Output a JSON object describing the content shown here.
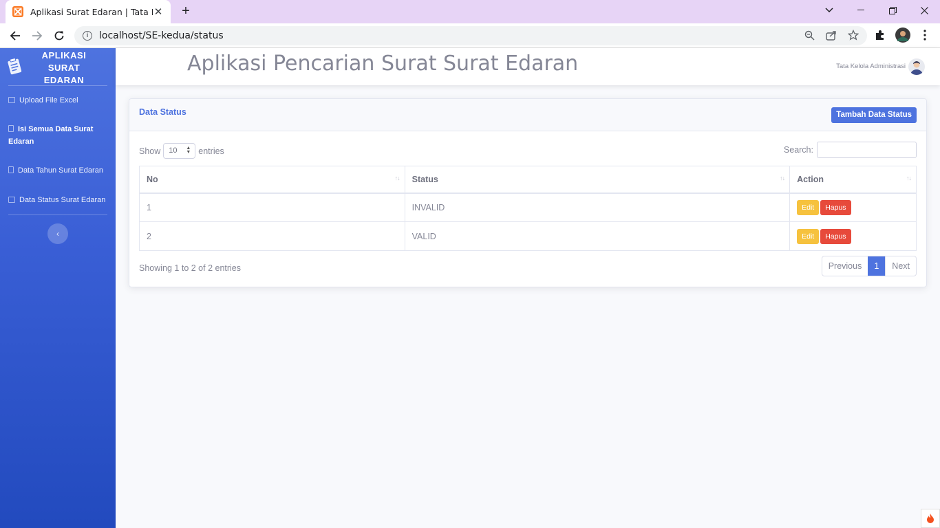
{
  "browser": {
    "tab_title": "Aplikasi Surat Edaran | Tata Kelola",
    "tab_close": "✕",
    "new_tab": "+",
    "url": "localhost/SE-kedua/status"
  },
  "sidebar": {
    "brand_lines": [
      "APLIKASI",
      "SURAT",
      "EDARAN"
    ],
    "items": [
      {
        "label": "Upload File Excel",
        "icon": "table-icon"
      },
      {
        "label": "Isi Semua Data Surat Edaran",
        "icon": "file-icon"
      },
      {
        "label": "Data Tahun Surat Edaran",
        "icon": "calendar-icon"
      },
      {
        "label": "Data Status Surat Edaran",
        "icon": "table-icon"
      }
    ],
    "toggle_glyph": "‹"
  },
  "topbar": {
    "title": "Aplikasi Pencarian Surat Surat Edaran",
    "user_name": "Tata Kelola Administrasi"
  },
  "card": {
    "title": "Data Status",
    "add_button": "Tambah Data Status",
    "length": {
      "show": "Show",
      "value": "10",
      "entries": "entries"
    },
    "search_label": "Search:",
    "columns": [
      "No",
      "Status",
      "Action"
    ],
    "rows": [
      {
        "no": "1",
        "status": "INVALID"
      },
      {
        "no": "2",
        "status": "VALID"
      }
    ],
    "edit_label": "Edit",
    "delete_label": "Hapus",
    "info": "Showing 1 to 2 of 2 entries",
    "pager": {
      "previous": "Previous",
      "current": "1",
      "next": "Next"
    }
  },
  "colors": {
    "primary": "#4e73df",
    "warning": "#f6c23e",
    "danger": "#e74a3b",
    "tabbar": "#e7d4f6"
  }
}
